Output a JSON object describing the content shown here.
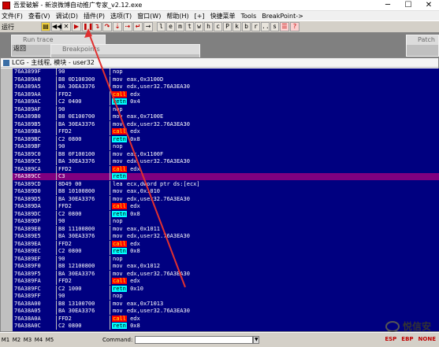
{
  "window": {
    "title": "吾爱破解 - 新浪微博自动推广专家_v2.12.exe"
  },
  "menu": [
    "文件(F)",
    "查看(V)",
    "调试(D)",
    "插件(P)",
    "选项(T)",
    "窗口(W)",
    "帮助(H)",
    "[+]",
    "快捷菜单",
    "Tools",
    "BreakPoint->"
  ],
  "toolbar": {
    "state": "运行",
    "buttons": [
      "folder",
      "rewind",
      "x",
      "play",
      "pause",
      "step-into",
      "step-over",
      "trace-into",
      "trace-over",
      "execute-till-return",
      "go-to"
    ],
    "letters": [
      "l",
      "e",
      "m",
      "t",
      "w",
      "h",
      "c",
      "P",
      "k",
      "b",
      "r",
      "...",
      "s"
    ]
  },
  "bg_windows": {
    "run_trace": "Run trace",
    "breakpoints": "Breakpoints",
    "back_label": "返回",
    "right_cap": "Patch"
  },
  "cpu_window": {
    "caption": "LCG - 主线程, 模块 - user32"
  },
  "rows": [
    {
      "addr": "76A3899F",
      "hex": "90",
      "mn": "nop",
      "cls": "nop",
      "op": ""
    },
    {
      "addr": "76A389A0",
      "hex": "B8 0D100300",
      "mn": "mov",
      "cls": "mov",
      "op": " eax,0x3100D"
    },
    {
      "addr": "76A389A5",
      "hex": "BA 30EA3376",
      "mn": "mov",
      "cls": "mov",
      "op": " edx,user32.76A3EA30"
    },
    {
      "addr": "76A389AA",
      "hex": "FFD2",
      "mn": "call",
      "cls": "call",
      "op": " edx"
    },
    {
      "addr": "76A389AC",
      "hex": "C2 0400",
      "mn": "retn",
      "cls": "retn",
      "op": " 0x4"
    },
    {
      "addr": "76A389AF",
      "hex": "90",
      "mn": "nop",
      "cls": "nop",
      "op": ""
    },
    {
      "addr": "76A389B0",
      "hex": "B8 0E100700",
      "mn": "mov",
      "cls": "mov",
      "op": " eax,0x7100E"
    },
    {
      "addr": "76A389B5",
      "hex": "BA 30EA3376",
      "mn": "mov",
      "cls": "mov",
      "op": " edx,user32.76A3EA30"
    },
    {
      "addr": "76A389BA",
      "hex": "FFD2",
      "mn": "call",
      "cls": "call",
      "op": " edx"
    },
    {
      "addr": "76A389BC",
      "hex": "C2 0800",
      "mn": "retn",
      "cls": "retn",
      "op": " 0x8"
    },
    {
      "addr": "76A389BF",
      "hex": "90",
      "mn": "nop",
      "cls": "nop",
      "op": ""
    },
    {
      "addr": "76A389C0",
      "hex": "B8 0F100100",
      "mn": "mov",
      "cls": "mov",
      "op": " eax,0x1100F"
    },
    {
      "addr": "76A389C5",
      "hex": "BA 30EA3376",
      "mn": "mov",
      "cls": "mov",
      "op": " edx,user32.76A3EA30"
    },
    {
      "addr": "76A389CA",
      "hex": "FFD2",
      "mn": "call",
      "cls": "call",
      "op": " edx"
    },
    {
      "addr": "76A389CC",
      "hex": "C3",
      "mn": "retn",
      "cls": "retn",
      "op": "",
      "sel": true
    },
    {
      "addr": "76A389CD",
      "hex": "8D49 00",
      "mn": "lea",
      "cls": "lea",
      "op": " ecx,dword ptr ds:[ecx]"
    },
    {
      "addr": "76A389D0",
      "hex": "B8 10100800",
      "mn": "mov",
      "cls": "mov",
      "op": " eax,0x1010"
    },
    {
      "addr": "76A389D5",
      "hex": "BA 30EA3376",
      "mn": "mov",
      "cls": "mov",
      "op": " edx,user32.76A3EA30"
    },
    {
      "addr": "76A389DA",
      "hex": "FFD2",
      "mn": "call",
      "cls": "call",
      "op": " edx"
    },
    {
      "addr": "76A389DC",
      "hex": "C2 0800",
      "mn": "retn",
      "cls": "retn",
      "op": " 0x8"
    },
    {
      "addr": "76A389DF",
      "hex": "90",
      "mn": "nop",
      "cls": "nop",
      "op": ""
    },
    {
      "addr": "76A389E0",
      "hex": "B8 11100800",
      "mn": "mov",
      "cls": "mov",
      "op": " eax,0x1011"
    },
    {
      "addr": "76A389E5",
      "hex": "BA 30EA3376",
      "mn": "mov",
      "cls": "mov",
      "op": " edx,user32.76A3EA30"
    },
    {
      "addr": "76A389EA",
      "hex": "FFD2",
      "mn": "call",
      "cls": "call",
      "op": " edx"
    },
    {
      "addr": "76A389EC",
      "hex": "C2 0800",
      "mn": "retn",
      "cls": "retn",
      "op": " 0x8"
    },
    {
      "addr": "76A389EF",
      "hex": "90",
      "mn": "nop",
      "cls": "nop",
      "op": ""
    },
    {
      "addr": "76A389F0",
      "hex": "B8 12100800",
      "mn": "mov",
      "cls": "mov",
      "op": " eax,0x1012"
    },
    {
      "addr": "76A389F5",
      "hex": "BA 30EA3376",
      "mn": "mov",
      "cls": "mov",
      "op": " edx,user32.76A3EA30"
    },
    {
      "addr": "76A389FA",
      "hex": "FFD2",
      "mn": "call",
      "cls": "call",
      "op": " edx"
    },
    {
      "addr": "76A389FC",
      "hex": "C2 1000",
      "mn": "retn",
      "cls": "retn",
      "op": " 0x10"
    },
    {
      "addr": "76A389FF",
      "hex": "90",
      "mn": "nop",
      "cls": "nop",
      "op": ""
    },
    {
      "addr": "76A38A00",
      "hex": "B8 13100700",
      "mn": "mov",
      "cls": "mov",
      "op": " eax,0x71013"
    },
    {
      "addr": "76A38A05",
      "hex": "BA 30EA3376",
      "mn": "mov",
      "cls": "mov",
      "op": " edx,user32.76A3EA30"
    },
    {
      "addr": "76A38A0A",
      "hex": "FFD2",
      "mn": "call",
      "cls": "call",
      "op": " edx"
    },
    {
      "addr": "76A38A0C",
      "hex": "C2 0800",
      "mn": "retn",
      "cls": "retn",
      "op": " 0x8"
    }
  ],
  "statusbar": {
    "m_buttons": [
      "M1",
      "M2",
      "M3",
      "M4",
      "M5"
    ],
    "command_label": "Command:",
    "flags": [
      "ESP",
      "EBP",
      "NONE"
    ]
  },
  "watermark": "悦信安",
  "colors": {
    "cpu_bg": "#000080",
    "call_bg": "#ff0000",
    "retn_bg": "#00ffff",
    "selected_row": "#800080",
    "arrow": "#e03030"
  }
}
